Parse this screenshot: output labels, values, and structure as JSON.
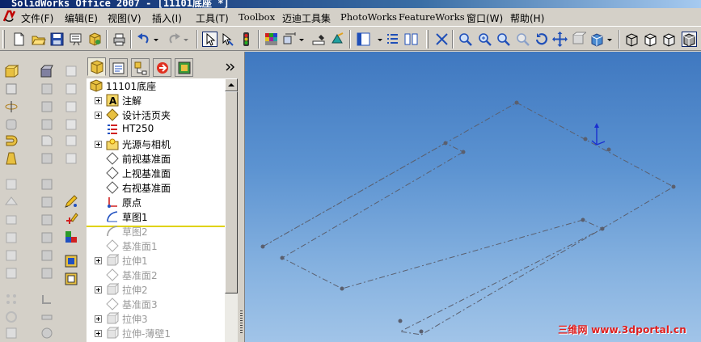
{
  "window": {
    "title": "SolidWorks Office 2007 - [11101底座 *]"
  },
  "menubar": {
    "items": [
      {
        "label": "文件(F)"
      },
      {
        "label": "编辑(E)"
      },
      {
        "label": "视图(V)"
      },
      {
        "label": "插入(I)"
      },
      {
        "label": "工具(T)"
      },
      {
        "label": "Toolbox"
      },
      {
        "label": "迈迪工具集"
      },
      {
        "label": "PhotoWorks"
      },
      {
        "label": "FeatureWorks"
      },
      {
        "label": "窗口(W)"
      },
      {
        "label": "帮助(H)"
      }
    ]
  },
  "toolbar": {
    "icons": [
      "new-document-icon",
      "open-folder-icon",
      "save-icon",
      "print-preview-icon",
      "properties-icon",
      "print-icon",
      "undo-icon",
      "redo-icon",
      "select-icon",
      "select-filter-icon",
      "traffic-light-icon",
      "color-icon",
      "dimension-icon",
      "measure-icon",
      "reference-icon",
      "view-panel-icon",
      "list-icon",
      "tile-icon",
      "zoom-to-fit-icon",
      "zoom-area-icon",
      "zoom-in-out-icon",
      "zoom-selection-icon",
      "rotate-icon",
      "pan-icon",
      "section-icon",
      "view-orientation-icon",
      "wireframe-icon",
      "hidden-lines-icon",
      "shaded-icon"
    ]
  },
  "feature_manager": {
    "tabs": [
      "feature-tree-tab",
      "property-manager-tab",
      "configuration-tab",
      "dimxpert-tab",
      "display-tab"
    ],
    "tree": [
      {
        "label": "11101底座",
        "icon": "part-icon",
        "expandable": false,
        "suppressed": false
      },
      {
        "label": "注解",
        "icon": "annotations-icon",
        "expandable": true,
        "suppressed": false
      },
      {
        "label": "设计活页夹",
        "icon": "design-binder-icon",
        "expandable": true,
        "suppressed": false
      },
      {
        "label": "HT250",
        "icon": "material-icon",
        "expandable": false,
        "suppressed": false
      },
      {
        "label": "光源与相机",
        "icon": "lights-camera-icon",
        "expandable": true,
        "suppressed": false
      },
      {
        "label": "前视基准面",
        "icon": "plane-icon",
        "expandable": false,
        "suppressed": false
      },
      {
        "label": "上视基准面",
        "icon": "plane-icon",
        "expandable": false,
        "suppressed": false
      },
      {
        "label": "右视基准面",
        "icon": "plane-icon",
        "expandable": false,
        "suppressed": false
      },
      {
        "label": "原点",
        "icon": "origin-icon",
        "expandable": false,
        "suppressed": false
      },
      {
        "label": "草图1",
        "icon": "sketch-icon",
        "expandable": false,
        "suppressed": false
      },
      {
        "label": "草图2",
        "icon": "sketch-icon",
        "expandable": false,
        "suppressed": true
      },
      {
        "label": "基准面1",
        "icon": "plane-icon",
        "expandable": false,
        "suppressed": true
      },
      {
        "label": "拉伸1",
        "icon": "extrude-icon",
        "expandable": true,
        "suppressed": true
      },
      {
        "label": "基准面2",
        "icon": "plane-icon",
        "expandable": false,
        "suppressed": true
      },
      {
        "label": "拉伸2",
        "icon": "extrude-icon",
        "expandable": true,
        "suppressed": true
      },
      {
        "label": "基准面3",
        "icon": "plane-icon",
        "expandable": false,
        "suppressed": true
      },
      {
        "label": "拉伸3",
        "icon": "extrude-icon",
        "expandable": true,
        "suppressed": true
      },
      {
        "label": "拉伸-薄壁1",
        "icon": "extrude-icon",
        "expandable": true,
        "suppressed": true
      }
    ]
  },
  "graphics": {
    "watermark": "三维网 www.3dportal.cn",
    "colors": {
      "sketch_line": "#5a5f6e",
      "origin": "#1a2fd0",
      "rollback_bar": "#e0d200",
      "watermark": "#e01e1e"
    }
  }
}
